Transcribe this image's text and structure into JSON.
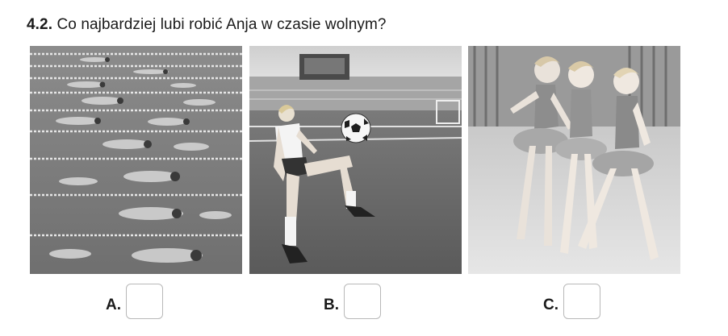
{
  "question": {
    "number": "4.2.",
    "text": " Co najbardziej lubi robić Anja w czasie wolnym?"
  },
  "images": [
    {
      "icon": "swimming-race-photo"
    },
    {
      "icon": "girl-playing-football-photo"
    },
    {
      "icon": "girls-ballet-gymnastics-photo"
    }
  ],
  "answers": [
    {
      "letter": "A."
    },
    {
      "letter": "B."
    },
    {
      "letter": "C."
    }
  ],
  "colors": {
    "text": "#1a1a1a",
    "box_border": "#b8b8b8"
  }
}
